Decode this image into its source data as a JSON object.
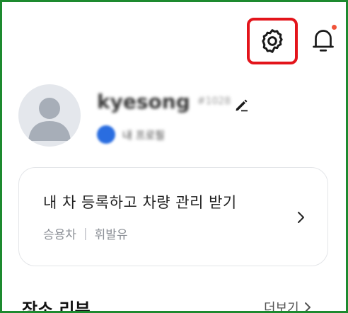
{
  "profile": {
    "nickname": "kyesong",
    "nickname_suffix": "#1028",
    "badge_text": "내 프로필",
    "avatar_icon": "person-placeholder-icon"
  },
  "header": {
    "settings_icon": "gear-icon",
    "notifications_icon": "bell-icon",
    "notification_dot_color": "#f0533a",
    "highlight_color": "#e3141b"
  },
  "car_card": {
    "title": "내 차 등록하고 차량 관리 받기",
    "car_type": "승용차",
    "separator": "|",
    "fuel_type": "휘발유",
    "arrow_icon": "chevron-right-icon"
  },
  "reviews_section": {
    "title": "장소 리뷰",
    "more_label": "더보기"
  }
}
